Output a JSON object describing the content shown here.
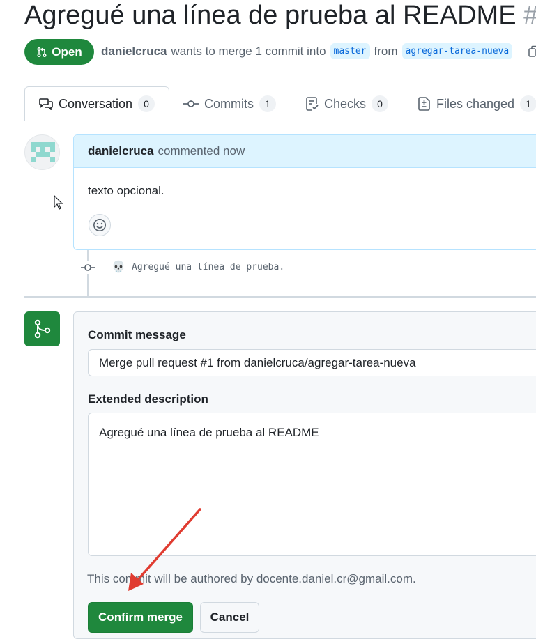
{
  "pr": {
    "title": "Agregué una línea de prueba al README",
    "number_fragment": "#",
    "state": "Open",
    "author": "danielcruca",
    "merge_text": "wants to merge 1 commit into",
    "base_branch": "master",
    "from_text": "from",
    "head_branch": "agregar-tarea-nueva"
  },
  "tabs": [
    {
      "label": "Conversation",
      "count": "0"
    },
    {
      "label": "Commits",
      "count": "1"
    },
    {
      "label": "Checks",
      "count": "0"
    },
    {
      "label": "Files changed",
      "count": "1"
    }
  ],
  "comment": {
    "author": "danielcruca",
    "meta": "commented now",
    "body": "texto opcional."
  },
  "timeline": {
    "commit_message": "Agregué una línea de prueba."
  },
  "merge": {
    "commit_message_label": "Commit message",
    "commit_message_value": "Merge pull request #1 from danielcruca/agregar-tarea-nueva",
    "extended_label": "Extended description",
    "extended_value": "Agregué una línea de prueba al README",
    "author_note": "This commit will be authored by docente.daniel.cr@gmail.com.",
    "confirm_label": "Confirm merge",
    "cancel_label": "Cancel"
  },
  "icons": {
    "state": "git-pull-request-icon",
    "copy": "copy-icon",
    "conversation": "comment-discussion-icon",
    "commits": "git-commit-icon",
    "checks": "checklist-icon",
    "files": "file-diff-icon",
    "reaction": "smiley-icon",
    "merge": "git-merge-icon",
    "cursor": "mouse-pointer-icon"
  },
  "colors": {
    "accent_green": "#1f883d",
    "link_blue": "#0969da",
    "comment_header_bg": "#ddf4ff",
    "annotation_red": "#e03c31"
  }
}
